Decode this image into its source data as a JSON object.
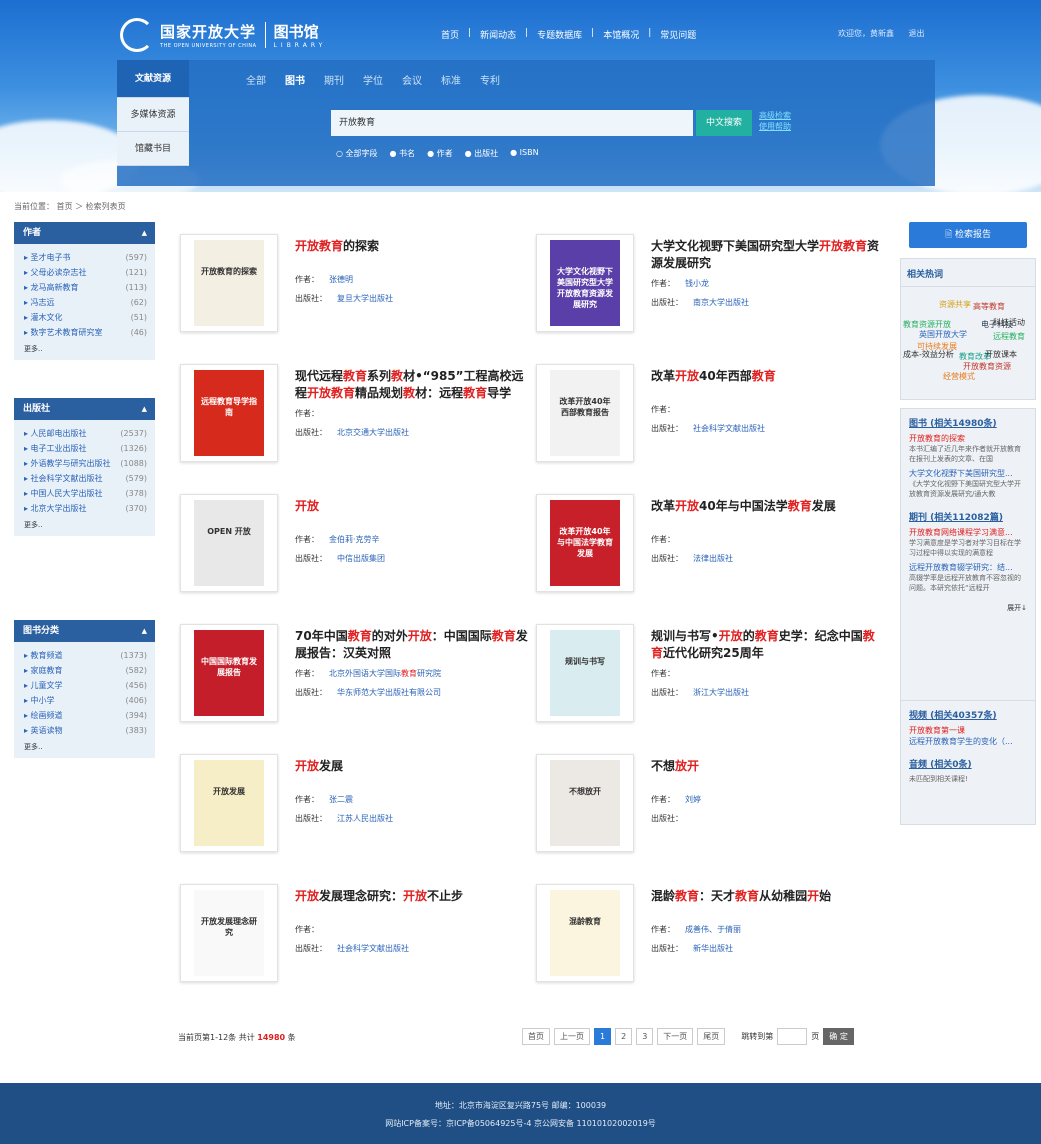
{
  "header": {
    "logo_cn": "国家开放大学",
    "logo_en": "THE OPEN UNIVERSITY OF CHINA",
    "library_cn": "图书馆",
    "library_en": "LIBRARY",
    "nav": [
      "首页",
      "新闻动态",
      "专题数据库",
      "本馆概况",
      "常见问题"
    ],
    "welcome": "欢迎您，黄新鑫",
    "logout": "退出"
  },
  "search": {
    "left_tabs": [
      "文献资源",
      "多媒体资源",
      "馆藏书目"
    ],
    "types": [
      "全部",
      "图书",
      "期刊",
      "学位",
      "会议",
      "标准",
      "专利"
    ],
    "query": "开放教育",
    "button": "中文搜索",
    "advanced": "高级检索",
    "help": "使用帮助",
    "radios": [
      "○ 全部字段",
      "● 书名",
      "● 作者",
      "● 出版社",
      "● ISBN"
    ]
  },
  "breadcrumb": "当前位置： 首页 ＞ 检索列表页",
  "facets": [
    {
      "title": "作者",
      "items": [
        {
          "label": "▸ 圣才电子书",
          "count": "(597)"
        },
        {
          "label": "▸ 父母必读杂志社",
          "count": "(121)"
        },
        {
          "label": "▸ 龙马高新教育",
          "count": "(113)"
        },
        {
          "label": "▸ 冯志远",
          "count": "(62)"
        },
        {
          "label": "▸ 灌木文化",
          "count": "(51)"
        },
        {
          "label": "▸ 数字艺术教育研究室",
          "count": "(46)"
        }
      ],
      "more": "更多.."
    },
    {
      "title": "出版社",
      "items": [
        {
          "label": "▸ 人民邮电出版社",
          "count": "(2537)"
        },
        {
          "label": "▸ 电子工业出版社",
          "count": "(1326)"
        },
        {
          "label": "▸ 外语教学与研究出版社",
          "count": "(1088)"
        },
        {
          "label": "▸ 社会科学文献出版社",
          "count": "(579)"
        },
        {
          "label": "▸ 中国人民大学出版社",
          "count": "(378)"
        },
        {
          "label": "▸ 北京大学出版社",
          "count": "(370)"
        }
      ],
      "more": "更多.."
    },
    {
      "title": "图书分类",
      "items": [
        {
          "label": "▸ 教育频道",
          "count": "(1373)"
        },
        {
          "label": "▸ 家庭教育",
          "count": "(582)"
        },
        {
          "label": "▸ 儿童文学",
          "count": "(456)"
        },
        {
          "label": "▸ 中小学",
          "count": "(406)"
        },
        {
          "label": "▸ 绘画频道",
          "count": "(394)"
        },
        {
          "label": "▸ 英语读物",
          "count": "(383)"
        }
      ],
      "more": "更多.."
    }
  ],
  "labels": {
    "author": "作者：",
    "publisher": "出版社："
  },
  "books": [
    {
      "title_parts": [
        [
          "开放教育",
          true
        ],
        [
          "的探索",
          false
        ]
      ],
      "author": "张德明",
      "publisher": "复旦大学出版社"
    },
    {
      "title_parts": [
        [
          "大学文化视野下美国研究型大学",
          false
        ],
        [
          "开放教育",
          true
        ],
        [
          "资源发展研究",
          false
        ]
      ],
      "author": "钱小龙",
      "publisher": "南京大学出版社"
    },
    {
      "title_parts": [
        [
          "现代远程",
          false
        ],
        [
          "教育",
          true
        ],
        [
          "系列",
          false
        ],
        [
          "教",
          true
        ],
        [
          "材•“985”工程高校远程",
          false
        ],
        [
          "开放教育",
          true
        ],
        [
          "精品规划",
          false
        ],
        [
          "教",
          true
        ],
        [
          "材：远程",
          false
        ],
        [
          "教育",
          true
        ],
        [
          "导学",
          false
        ]
      ],
      "author": "",
      "publisher": "北京交通大学出版社"
    },
    {
      "title_parts": [
        [
          "改革",
          false
        ],
        [
          "开放",
          true
        ],
        [
          "40年西部",
          false
        ],
        [
          "教育",
          true
        ]
      ],
      "author": "",
      "publisher": "社会科学文献出版社"
    },
    {
      "title_parts": [
        [
          "开放",
          true
        ]
      ],
      "author": "金伯莉·克劳辛",
      "publisher": "中信出版集团"
    },
    {
      "title_parts": [
        [
          "改革",
          false
        ],
        [
          "开放",
          true
        ],
        [
          "40年与中国法学",
          false
        ],
        [
          "教育",
          true
        ],
        [
          "发展",
          false
        ]
      ],
      "author": "",
      "publisher": "法律出版社"
    },
    {
      "title_parts": [
        [
          "70年中国",
          false
        ],
        [
          "教育",
          true
        ],
        [
          "的对外",
          false
        ],
        [
          "开放",
          true
        ],
        [
          "：中国国际",
          false
        ],
        [
          "教育",
          true
        ],
        [
          "发展报告：汉英对照",
          false
        ]
      ],
      "author_parts": [
        [
          "北京外国语大学国际",
          false
        ],
        [
          "教育",
          true
        ],
        [
          "研究院",
          false
        ]
      ],
      "publisher": "华东师范大学出版社有限公司"
    },
    {
      "title_parts": [
        [
          "规训与书写•",
          false
        ],
        [
          "开放",
          true
        ],
        [
          "的",
          false
        ],
        [
          "教育",
          true
        ],
        [
          "史学：纪念中国",
          false
        ],
        [
          "教育",
          true
        ],
        [
          "近代化研究25周年",
          false
        ]
      ],
      "author": "",
      "publisher": "浙江大学出版社"
    },
    {
      "title_parts": [
        [
          "开放",
          true
        ],
        [
          "发展",
          false
        ]
      ],
      "author": "张二震",
      "publisher": "江苏人民出版社"
    },
    {
      "title_parts": [
        [
          "不想",
          false
        ],
        [
          "放开",
          true
        ]
      ],
      "author": "刘婷",
      "publisher": ""
    },
    {
      "title_parts": [
        [
          "开放",
          true
        ],
        [
          "发展理念研究：",
          false
        ],
        [
          "开放",
          true
        ],
        [
          "不止步",
          false
        ]
      ],
      "author": "",
      "publisher": "社会科学文献出版社"
    },
    {
      "title_parts": [
        [
          "混龄",
          false
        ],
        [
          "教育",
          true
        ],
        [
          "：天才",
          false
        ],
        [
          "教育",
          true
        ],
        [
          "从幼稚园",
          false
        ],
        [
          "开",
          true
        ],
        [
          "始",
          false
        ]
      ],
      "author": "成善伟、于倩丽",
      "publisher": "新华出版社"
    }
  ],
  "covers": [
    {
      "text": "开放教育的探索",
      "color": "#f4efe3"
    },
    {
      "text": "大学文化视野下美国研究型大学开放教育资源发展研究",
      "color": "#5b3fa8"
    },
    {
      "text": "远程教育导学指南",
      "color": "#d62a1c"
    },
    {
      "text": "改革开放40年西部教育报告",
      "color": "#f2f2f2"
    },
    {
      "text": "OPEN 开放",
      "color": "#e8e8e8"
    },
    {
      "text": "改革开放40年与中国法学教育发展",
      "color": "#c8202a"
    },
    {
      "text": "中国国际教育发展报告",
      "color": "#c41e2a"
    },
    {
      "text": "规训与书写",
      "color": "#d9ecef"
    },
    {
      "text": "开放发展",
      "color": "#f6eec6"
    },
    {
      "text": "不想放开",
      "color": "#ece8e3"
    },
    {
      "text": "开放发展理念研究",
      "color": "#f9f9f9"
    },
    {
      "text": "混龄教育",
      "color": "#fbf4de"
    }
  ],
  "pagination": {
    "summary_pre": "当前页第1-12条 共计",
    "total": "14980",
    "summary_post": "条",
    "buttons": [
      "首页",
      "上一页",
      "1",
      "2",
      "3",
      "下一页",
      "尾页"
    ],
    "jump_label": "跳转到第",
    "page_word": "页",
    "confirm": "确 定"
  },
  "right": {
    "report_button": "检索报告",
    "hot_title": "相关热词",
    "hot_words": [
      {
        "text": "资源共享",
        "color": "#d4a017"
      },
      {
        "text": "高等教育",
        "color": "#c0392b"
      },
      {
        "text": "教育资源开放",
        "color": "#27ae60"
      },
      {
        "text": "电子科技",
        "color": "#2c3e50"
      },
      {
        "text": "科技活动",
        "color": "#333"
      },
      {
        "text": "英国开放大学",
        "color": "#2a63b8"
      },
      {
        "text": "远程教育",
        "color": "#27ae60"
      },
      {
        "text": "可持续发展",
        "color": "#e67e22"
      },
      {
        "text": "成本-效益分析",
        "color": "#333"
      },
      {
        "text": "教育改革",
        "color": "#16a085"
      },
      {
        "text": "开放课本",
        "color": "#333"
      },
      {
        "text": "开放教育资源",
        "color": "#c0392b"
      },
      {
        "text": "经营模式",
        "color": "#e67e22"
      }
    ],
    "books_title": "图书 (相关14980条)",
    "books_items": [
      {
        "title": "开放教育的探索",
        "desc": "本书汇编了近几年来作者就开放教育在报刊上发表的文章、在国"
      },
      {
        "title": "大学文化视野下美国研究型...",
        "desc": "《大学文化视野下美国研究型大学开放教育资源发展研究/通大教"
      }
    ],
    "journals_title": "期刊 (相关112082篇)",
    "journals_items": [
      {
        "title": "开放教育网络课程学习满意...",
        "desc": "学习满意度是学习者对学习目标在学习过程中得以实现的满意程"
      },
      {
        "title": "远程开放教育辍学研究：结...",
        "desc": "高辍学率是远程开放教育不容忽视的问题。本研究依托“远程开"
      }
    ],
    "expand": "展开↓",
    "video_title": "视频 (相关40357条)",
    "video_items": [
      "开放教育第一课",
      "远程开放教育学生的变化（..."
    ],
    "audio_title": "音频 (相关0条)",
    "audio_empty": "未匹配到相关课程!"
  },
  "footer": {
    "address": "地址：北京市海淀区复兴路75号 邮编：100039",
    "icp": "网站ICP备案号：京ICP备05064925号-4 京公网安备 11010102002019号"
  }
}
